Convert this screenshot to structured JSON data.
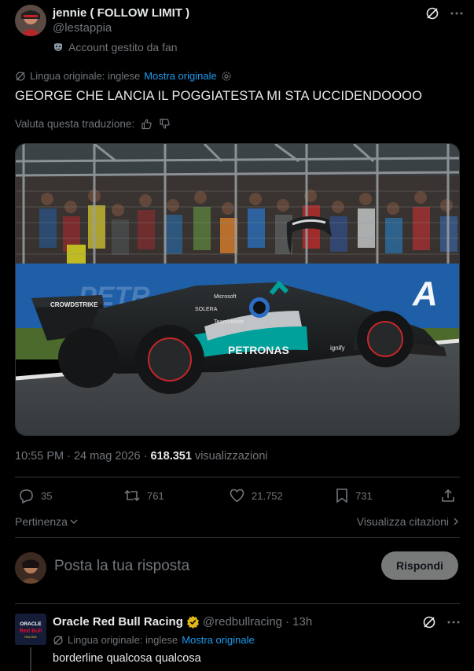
{
  "tweet": {
    "author_name": "jennie ( FOLLOW LIMIT )",
    "author_handle": "@lestappia",
    "fan_account_label": "Account gestito da fan",
    "lang_label": "Lingua originale: inglese",
    "show_original": "Mostra originale",
    "text": "GEORGE CHE LANCIA IL POGGIATESTA MI STA UCCIDENDOOOO",
    "rate_label": "Valuta questa traduzione:",
    "time": "10:55 PM · 24 mag 2026 ·",
    "views_count": "618.351",
    "views_label": "visualizzazioni",
    "image_texts": {
      "sponsor_top": "Microsoft",
      "sponsor_main": "PETRONAS",
      "sponsor_side": "CROWDSTRIKE",
      "sponsor_sol": "SOLERA",
      "sponsor_tv": "TeamViewer",
      "sponsor_ignify": "ignify"
    }
  },
  "actions": {
    "replies": "35",
    "reposts": "761",
    "likes": "21.752",
    "bookmarks": "731"
  },
  "sort": {
    "relevance": "Pertinenza",
    "view_quotes": "Visualizza citazioni"
  },
  "composer": {
    "placeholder": "Posta la tua risposta",
    "reply_button": "Rispondi"
  },
  "reply": {
    "author_name": "Oracle Red Bull Racing",
    "author_handle": "@redbullracing",
    "time": "· 13h",
    "lang_label": "Lingua originale: inglese",
    "show_original": "Mostra originale",
    "text": "borderline qualcosa qualcosa",
    "logo_text_top": "ORACLE",
    "logo_text_bottom": "Red Bull",
    "logo_text_small": "RACING"
  },
  "colors": {
    "background": "#000000",
    "accent": "#1d9bf0",
    "verified_gold": "#e2b719",
    "muted_text": "#71767b",
    "divider": "#2f3336"
  },
  "icons": [
    "avatar",
    "translate-icon",
    "more-icon",
    "fan-mask-icon",
    "settings-icon",
    "thumb-up-icon",
    "thumb-down-icon",
    "reply-icon",
    "repost-icon",
    "like-icon",
    "bookmark-icon",
    "share-icon",
    "chevron-down-icon",
    "chevron-right-icon",
    "verified-badge-icon"
  ]
}
